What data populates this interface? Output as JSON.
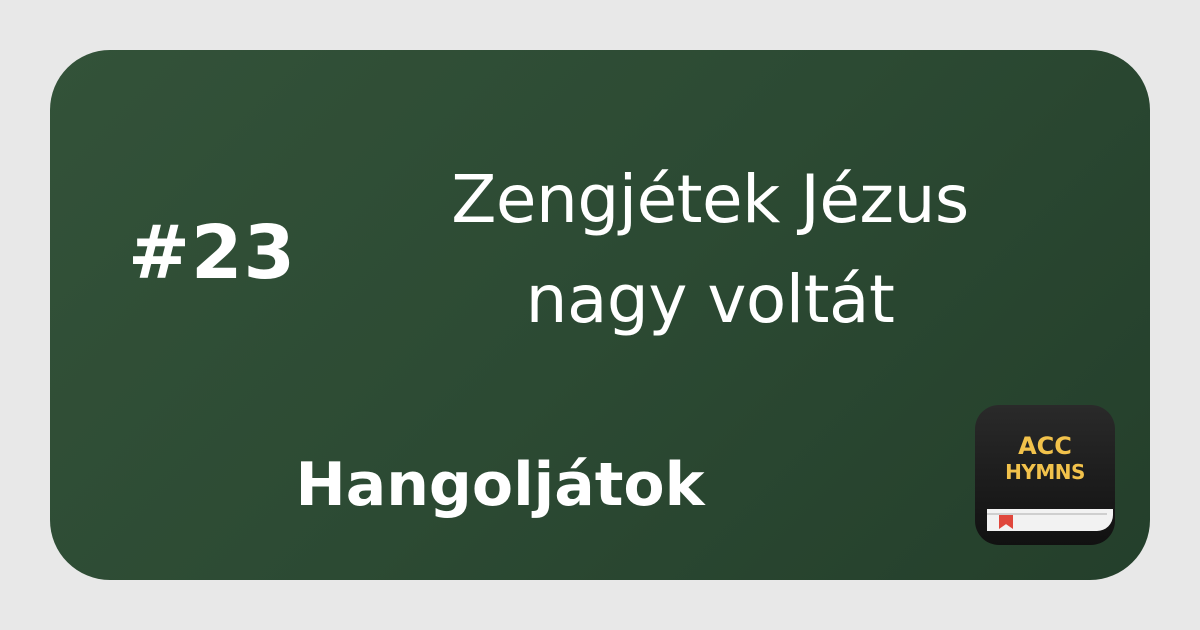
{
  "hymn": {
    "number": "#23",
    "title_line1": "Zengjétek Jézus",
    "title_line2": "nagy voltát",
    "category": "Hangoljátok"
  },
  "app_icon": {
    "line1": "ACC",
    "line2": "HYMNS",
    "icon": "hymn-book-icon"
  },
  "colors": {
    "card_background": "#2c4a33",
    "frame_background": "#e8e8e8",
    "text": "#ffffff",
    "icon_text": "#f2c24b",
    "bookmark": "#e0473c"
  }
}
